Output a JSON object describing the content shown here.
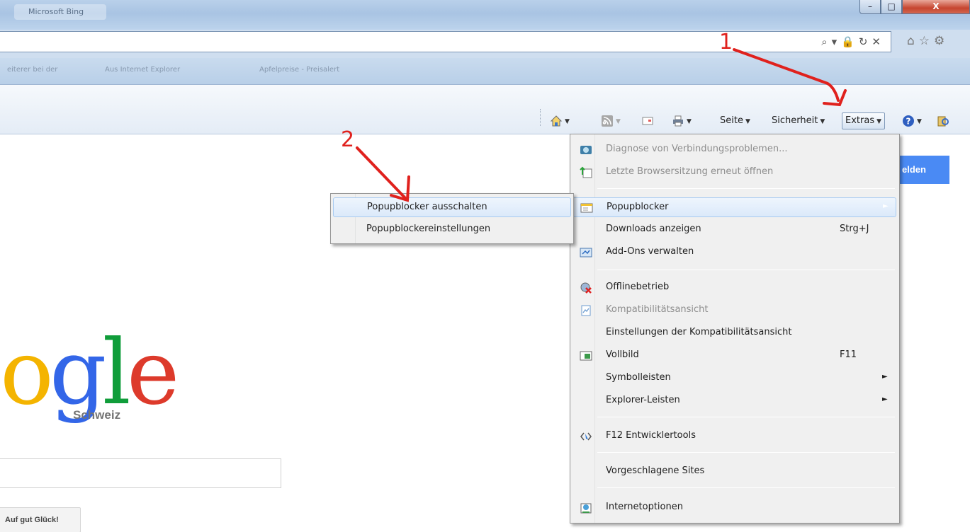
{
  "window": {
    "title": "Microsoft Bing",
    "buttons": {
      "minimize": "–",
      "maximize": "□",
      "close": "X"
    }
  },
  "address_bar": {
    "icons": [
      "search-icon",
      "dropdown-icon",
      "lock-icon",
      "refresh-icon",
      "stop-icon"
    ],
    "glyphs": "⌕▾🔒↻✕",
    "nav_glyphs": "⌂☆⚙"
  },
  "favorites_bar": {
    "items": [
      "eiterer bei der",
      "Aus Internet Explorer",
      "Apfelpreise - Preisalert"
    ]
  },
  "command_bar": {
    "seite": "Seite",
    "sicherheit": "Sicherheit",
    "extras": "Extras",
    "dropdown_glyph": "▼"
  },
  "google": {
    "logo_letters": {
      "o": "o",
      "g": "g",
      "l": "l",
      "e": "e"
    },
    "region": "Schweiz",
    "lucky_button": "Auf gut Glück!",
    "signin_button": "Anmelden",
    "signin_visible": "elden"
  },
  "extras_menu": {
    "items": [
      {
        "label": "Diagnose von Verbindungsproblemen...",
        "disabled": true,
        "icon": "network-diagnose-icon"
      },
      {
        "label": "Letzte Browsersitzung erneut öffnen",
        "disabled": true,
        "icon": "reopen-session-icon"
      },
      {
        "label": "Popupblocker",
        "icon": "popupblocker-icon",
        "submenu": true,
        "highlighted": true
      },
      {
        "label": "Downloads anzeigen",
        "shortcut": "Strg+J"
      },
      {
        "label": "Add-Ons verwalten",
        "icon": "addons-icon"
      },
      {
        "label": "Offlinebetrieb",
        "icon": "offline-icon"
      },
      {
        "label": "Kompatibilitätsansicht",
        "disabled": true,
        "icon": "compat-view-icon"
      },
      {
        "label": "Einstellungen der Kompatibilitätsansicht"
      },
      {
        "label": "Vollbild",
        "shortcut": "F11",
        "icon": "fullscreen-icon"
      },
      {
        "label": "Symbolleisten",
        "submenu": true
      },
      {
        "label": "Explorer-Leisten",
        "submenu": true
      },
      {
        "label": "F12 Entwicklertools",
        "icon": "devtools-icon"
      },
      {
        "label": "Vorgeschlagene Sites"
      },
      {
        "label": "Internetoptionen",
        "icon": "internet-options-icon"
      }
    ],
    "submenu_arrow": "►"
  },
  "popup_submenu": {
    "items": [
      {
        "label": "Popupblocker ausschalten",
        "highlighted": true
      },
      {
        "label": "Popupblockereinstellungen"
      }
    ]
  },
  "annotations": {
    "step1": "1",
    "step2": "2",
    "color": "#e0211d"
  }
}
